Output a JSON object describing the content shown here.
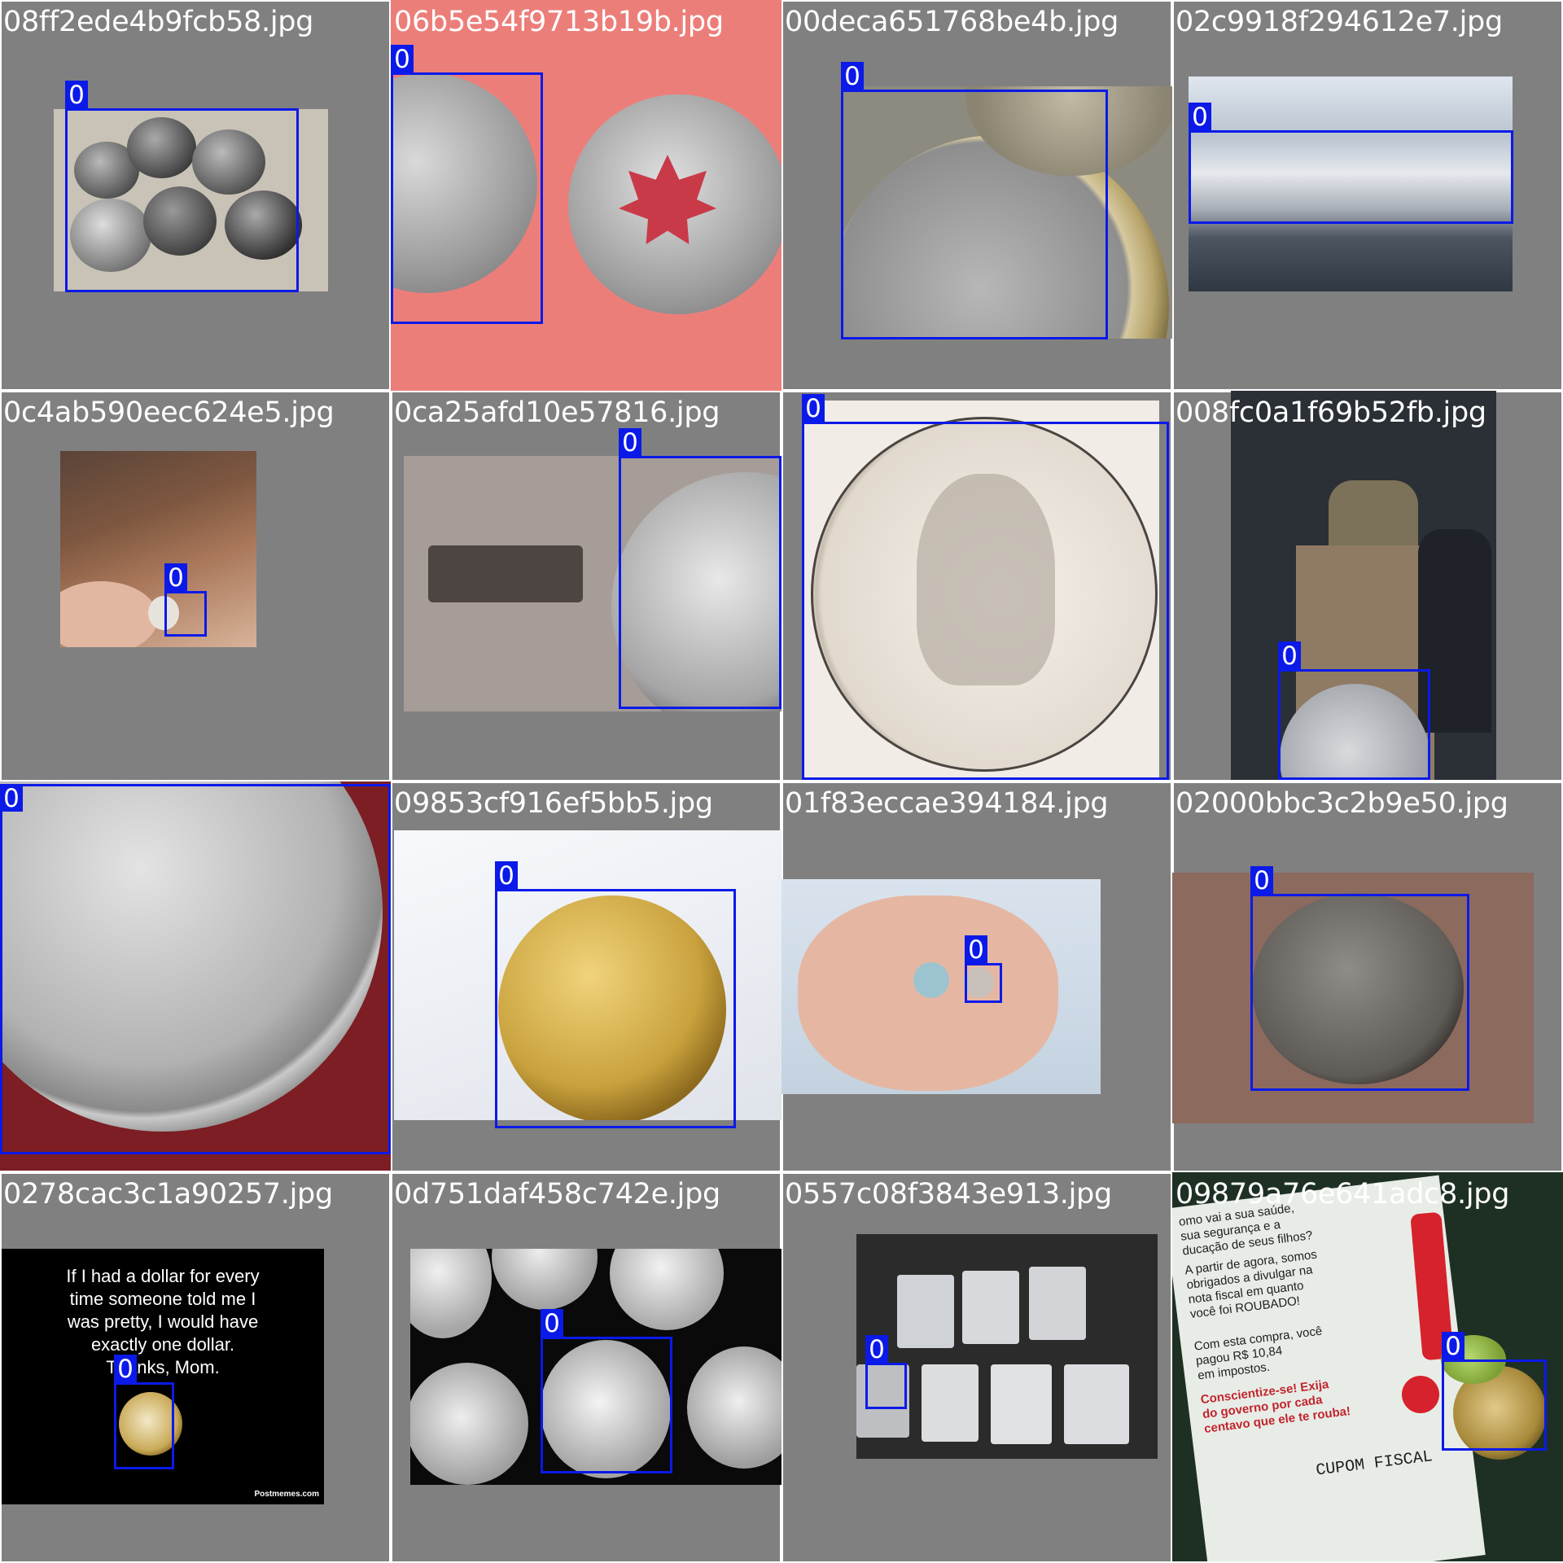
{
  "colors": {
    "tile_background": "#808080",
    "box_color": "#0b1ae8",
    "label_text_color": "#ffffff"
  },
  "tiles": [
    {
      "filename": "08ff2ede4b9fcb58.jpg",
      "boxes": [
        {
          "label": "0"
        }
      ]
    },
    {
      "filename": "06b5e54f9713b19b.jpg",
      "boxes": [
        {
          "label": "0"
        }
      ]
    },
    {
      "filename": "00deca651768be4b.jpg",
      "boxes": [
        {
          "label": "0"
        }
      ]
    },
    {
      "filename": "02c9918f294612e7.jpg",
      "boxes": [
        {
          "label": "0"
        }
      ]
    },
    {
      "filename": "0c4ab590eec624e5.jpg",
      "boxes": [
        {
          "label": "0"
        }
      ]
    },
    {
      "filename": "0ca25afd10e57816.jpg",
      "boxes": [
        {
          "label": "0"
        }
      ]
    },
    {
      "filename": "",
      "boxes": [
        {
          "label": "0"
        }
      ]
    },
    {
      "filename": "008fc0a1f69b52fb.jpg",
      "boxes": [
        {
          "label": "0"
        }
      ]
    },
    {
      "filename": "",
      "boxes": [
        {
          "label": "0"
        }
      ]
    },
    {
      "filename": "09853cf916ef5bb5.jpg",
      "boxes": [
        {
          "label": "0"
        }
      ]
    },
    {
      "filename": "01f83eccae394184.jpg",
      "boxes": [
        {
          "label": "0"
        }
      ]
    },
    {
      "filename": "02000bbc3c2b9e50.jpg",
      "boxes": [
        {
          "label": "0"
        }
      ]
    },
    {
      "filename": "0278cac3c1a90257.jpg",
      "boxes": [
        {
          "label": "0"
        }
      ],
      "meme_text": "If I had a dollar for every\ntime someone told me I\nwas pretty, I would have\nexactly one dollar.\nThanks, Mom.",
      "credit": "Postmemes.com"
    },
    {
      "filename": "0d751daf458c742e.jpg",
      "boxes": [
        {
          "label": "0"
        }
      ]
    },
    {
      "filename": "0557c08f3843e913.jpg",
      "boxes": [
        {
          "label": "0"
        }
      ]
    },
    {
      "filename": "09879a76e641adc8.jpg",
      "boxes": [
        {
          "label": "0"
        }
      ],
      "receipt_lines": [
        "omo vai a sua saúde,",
        "sua segurança e a",
        "ducação de seus filhos?",
        "A partir de agora, somos",
        "obrigados a divulgar na",
        "nota fiscal em quanto",
        "você foi ROUBADO!",
        "Com esta compra, você",
        "pagou R$ 10,84",
        "em impostos."
      ],
      "receipt_red_lines": [
        "Conscientize-se! Exija",
        "do governo por cada",
        "centavo que ele te rouba!"
      ],
      "receipt_footer": "CUPOM FISCAL"
    }
  ]
}
